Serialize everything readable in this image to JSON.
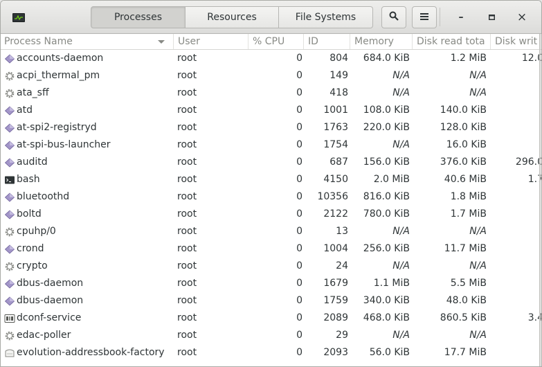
{
  "header": {
    "tabs": [
      {
        "label": "Processes",
        "active": true
      },
      {
        "label": "Resources",
        "active": false
      },
      {
        "label": "File Systems",
        "active": false
      }
    ],
    "search_icon": "search-icon",
    "menu_icon": "hamburger-menu-icon",
    "window_controls": {
      "minimize": "–",
      "maximize": "◘",
      "close": "×"
    }
  },
  "columns": [
    "Process Name",
    "User",
    "% CPU",
    "ID",
    "Memory",
    "Disk read tota",
    "Disk writ"
  ],
  "processes": [
    {
      "name": "accounts-daemon",
      "icon": "daemon",
      "user": "root",
      "cpu": "0",
      "id": "804",
      "memory": "684.0 KiB",
      "disk_read": "1.2 MiB",
      "disk_write": "12.0"
    },
    {
      "name": "acpi_thermal_pm",
      "icon": "gear",
      "user": "root",
      "cpu": "0",
      "id": "149",
      "memory": "N/A",
      "disk_read": "N/A",
      "disk_write": ""
    },
    {
      "name": "ata_sff",
      "icon": "gear",
      "user": "root",
      "cpu": "0",
      "id": "418",
      "memory": "N/A",
      "disk_read": "N/A",
      "disk_write": ""
    },
    {
      "name": "atd",
      "icon": "daemon",
      "user": "root",
      "cpu": "0",
      "id": "1001",
      "memory": "108.0 KiB",
      "disk_read": "140.0 KiB",
      "disk_write": ""
    },
    {
      "name": "at-spi2-registryd",
      "icon": "daemon",
      "user": "root",
      "cpu": "0",
      "id": "1763",
      "memory": "220.0 KiB",
      "disk_read": "128.0 KiB",
      "disk_write": ""
    },
    {
      "name": "at-spi-bus-launcher",
      "icon": "daemon",
      "user": "root",
      "cpu": "0",
      "id": "1754",
      "memory": "N/A",
      "disk_read": "16.0 KiB",
      "disk_write": ""
    },
    {
      "name": "auditd",
      "icon": "daemon",
      "user": "root",
      "cpu": "0",
      "id": "687",
      "memory": "156.0 KiB",
      "disk_read": "376.0 KiB",
      "disk_write": "296.0"
    },
    {
      "name": "bash",
      "icon": "terminal",
      "user": "root",
      "cpu": "0",
      "id": "4150",
      "memory": "2.0 MiB",
      "disk_read": "40.6 MiB",
      "disk_write": "1.7"
    },
    {
      "name": "bluetoothd",
      "icon": "daemon",
      "user": "root",
      "cpu": "0",
      "id": "10356",
      "memory": "816.0 KiB",
      "disk_read": "1.8 MiB",
      "disk_write": ""
    },
    {
      "name": "boltd",
      "icon": "daemon",
      "user": "root",
      "cpu": "0",
      "id": "2122",
      "memory": "780.0 KiB",
      "disk_read": "1.7 MiB",
      "disk_write": ""
    },
    {
      "name": "cpuhp/0",
      "icon": "gear",
      "user": "root",
      "cpu": "0",
      "id": "13",
      "memory": "N/A",
      "disk_read": "N/A",
      "disk_write": ""
    },
    {
      "name": "crond",
      "icon": "daemon",
      "user": "root",
      "cpu": "0",
      "id": "1004",
      "memory": "256.0 KiB",
      "disk_read": "11.7 MiB",
      "disk_write": ""
    },
    {
      "name": "crypto",
      "icon": "gear",
      "user": "root",
      "cpu": "0",
      "id": "24",
      "memory": "N/A",
      "disk_read": "N/A",
      "disk_write": ""
    },
    {
      "name": "dbus-daemon",
      "icon": "daemon",
      "user": "root",
      "cpu": "0",
      "id": "1679",
      "memory": "1.1 MiB",
      "disk_read": "5.5 MiB",
      "disk_write": ""
    },
    {
      "name": "dbus-daemon",
      "icon": "daemon",
      "user": "root",
      "cpu": "0",
      "id": "1759",
      "memory": "340.0 KiB",
      "disk_read": "48.0 KiB",
      "disk_write": ""
    },
    {
      "name": "dconf-service",
      "icon": "dconf",
      "user": "root",
      "cpu": "0",
      "id": "2089",
      "memory": "468.0 KiB",
      "disk_read": "860.5 KiB",
      "disk_write": "3.4"
    },
    {
      "name": "edac-poller",
      "icon": "gear",
      "user": "root",
      "cpu": "0",
      "id": "29",
      "memory": "N/A",
      "disk_read": "N/A",
      "disk_write": ""
    },
    {
      "name": "evolution-addressbook-factory",
      "icon": "addressbook",
      "user": "root",
      "cpu": "0",
      "id": "2093",
      "memory": "56.0 KiB",
      "disk_read": "17.7 MiB",
      "disk_write": ""
    }
  ],
  "colors": {
    "text": "#2e3436",
    "header_text": "#888a85",
    "daemon_icon": "#8d7fb8"
  }
}
